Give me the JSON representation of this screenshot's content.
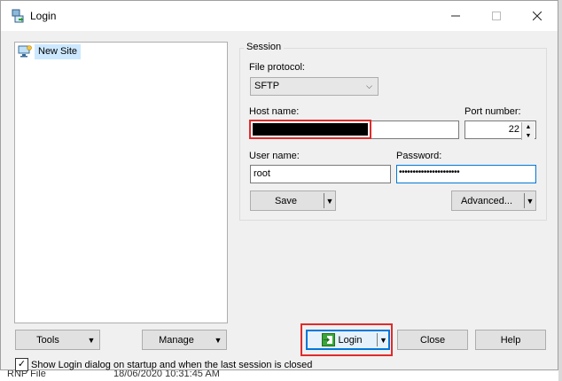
{
  "window": {
    "title": "Login"
  },
  "tree": {
    "items": [
      {
        "label": "New Site"
      }
    ]
  },
  "session": {
    "group_label": "Session",
    "file_protocol_label": "File protocol:",
    "file_protocol_value": "SFTP",
    "host_label": "Host name:",
    "port_label": "Port number:",
    "port_value": "22",
    "user_label": "User name:",
    "user_value": "root",
    "password_label": "Password:",
    "password_value": "••••••••••••••••••••••",
    "save_label": "Save",
    "advanced_label": "Advanced..."
  },
  "buttons": {
    "tools": "Tools",
    "manage": "Manage",
    "login": "Login",
    "close": "Close",
    "help": "Help"
  },
  "options": {
    "show_login_label": "Show Login dialog on startup and when the last session is closed",
    "show_login_checked": true
  },
  "background": {
    "file_name": "RNP File",
    "file_date": "18/06/2020 10:31:45 AM"
  },
  "colors": {
    "highlight": "#e02b2b",
    "accent": "#0078d7",
    "selection": "#cce8ff"
  }
}
